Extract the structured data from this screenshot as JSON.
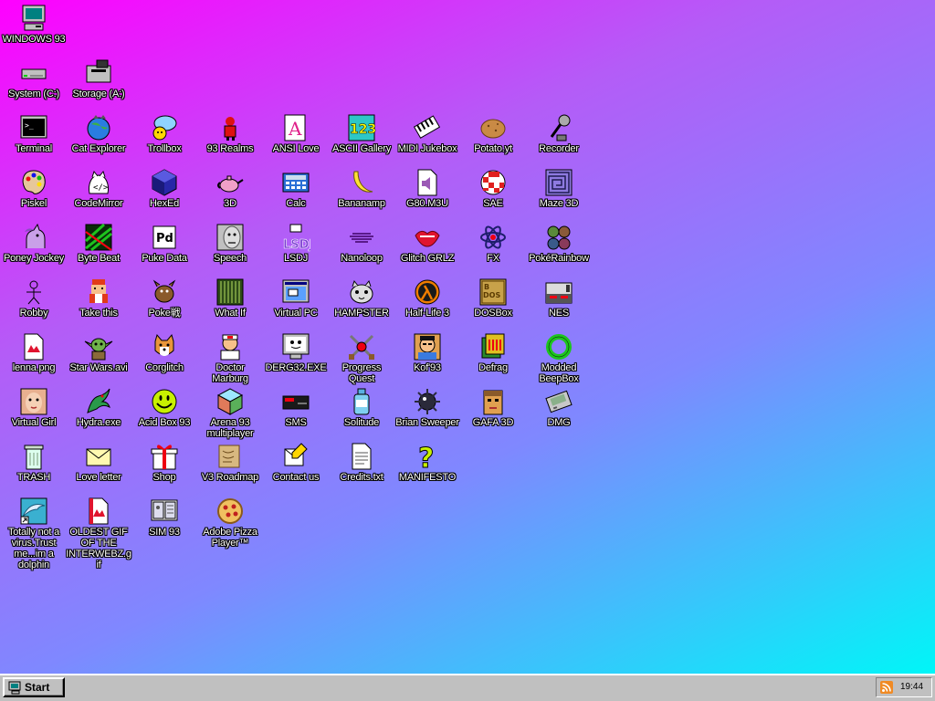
{
  "desktop": {
    "icons": [
      {
        "label": "WINDOWS 93",
        "icon": "computer-icon"
      },
      {
        "label": "System (C:)",
        "icon": "hard-drive-icon"
      },
      {
        "label": "Storage (A:)",
        "icon": "floppy-drive-icon"
      },
      {
        "label": "Terminal",
        "icon": "terminal-icon"
      },
      {
        "label": "Cat Explorer",
        "icon": "cat-globe-icon"
      },
      {
        "label": "Trollbox",
        "icon": "chat-bubble-icon"
      },
      {
        "label": "93 Realms",
        "icon": "knight-icon"
      },
      {
        "label": "ANSI Love",
        "icon": "font-a-icon"
      },
      {
        "label": "ASCII Gallery",
        "icon": "ascii-123-icon"
      },
      {
        "label": "MIDI Jukebox",
        "icon": "piano-keys-icon"
      },
      {
        "label": "Potato.yt",
        "icon": "potato-icon"
      },
      {
        "label": "Recorder",
        "icon": "microphone-icon"
      },
      {
        "label": "Piskel",
        "icon": "paint-palette-icon"
      },
      {
        "label": "CodeMirror",
        "icon": "cat-code-icon"
      },
      {
        "label": "HexEd",
        "icon": "hex-cube-icon"
      },
      {
        "label": "3D",
        "icon": "teapot-icon"
      },
      {
        "label": "Calc",
        "icon": "calculator-icon"
      },
      {
        "label": "Bananamp",
        "icon": "banana-icon"
      },
      {
        "label": "G80.M3U",
        "icon": "audio-file-icon"
      },
      {
        "label": "SAE",
        "icon": "checkered-ball-icon"
      },
      {
        "label": "Maze 3D",
        "icon": "maze-icon"
      },
      {
        "label": "Poney Jockey",
        "icon": "pony-icon"
      },
      {
        "label": "Byte Beat",
        "icon": "byte-beat-icon"
      },
      {
        "label": "Puke Data",
        "icon": "pd-icon"
      },
      {
        "label": "Speech",
        "icon": "speech-face-icon"
      },
      {
        "label": "LSDJ",
        "icon": "lsdj-icon"
      },
      {
        "label": "Nanoloop",
        "icon": "nanoloop-wave-icon"
      },
      {
        "label": "Glitch GRLZ",
        "icon": "lips-icon"
      },
      {
        "label": "FX",
        "icon": "atom-icon"
      },
      {
        "label": "PokéRainbow",
        "icon": "poke-rainbow-icon"
      },
      {
        "label": "Robby",
        "icon": "stick-figure-icon"
      },
      {
        "label": "Take this",
        "icon": "pixel-guy-icon"
      },
      {
        "label": "Poke戦",
        "icon": "poke-battle-icon"
      },
      {
        "label": "What If",
        "icon": "what-if-icon"
      },
      {
        "label": "Virtual PC",
        "icon": "virtual-pc-icon"
      },
      {
        "label": "HAMPSTER",
        "icon": "hamster-icon"
      },
      {
        "label": "Half-Life 3",
        "icon": "lambda-icon"
      },
      {
        "label": "DOSBox",
        "icon": "dosbox-icon"
      },
      {
        "label": "NES",
        "icon": "nes-console-icon"
      },
      {
        "label": "lenna.png",
        "icon": "image-file-icon"
      },
      {
        "label": "Star Wars.avi",
        "icon": "yoda-icon"
      },
      {
        "label": "Corglitch",
        "icon": "corgi-icon"
      },
      {
        "label": "Doctor Marburg",
        "icon": "doctor-icon"
      },
      {
        "label": "DERG32.EXE",
        "icon": "derg-monitor-icon"
      },
      {
        "label": "Progress Quest",
        "icon": "crossed-swords-icon"
      },
      {
        "label": "Kof'93",
        "icon": "fighter-icon"
      },
      {
        "label": "Defrag",
        "icon": "defrag-icon"
      },
      {
        "label": "Modded BeepBox",
        "icon": "ring-icon"
      },
      {
        "label": "Virtual Girl",
        "icon": "face-photo-icon"
      },
      {
        "label": "Hydra.exe",
        "icon": "hydra-icon"
      },
      {
        "label": "Acid Box 93",
        "icon": "smiley-icon"
      },
      {
        "label": "Arena 93 multiplayer",
        "icon": "cube-icon"
      },
      {
        "label": "SMS",
        "icon": "sms-console-icon"
      },
      {
        "label": "Solitude",
        "icon": "bottle-icon"
      },
      {
        "label": "Brian Sweeper",
        "icon": "mine-icon"
      },
      {
        "label": "GAFA 3D",
        "icon": "gafa-face-icon"
      },
      {
        "label": "DMG",
        "icon": "dmg-icon"
      },
      {
        "label": "TRASH",
        "icon": "trash-icon"
      },
      {
        "label": "Love letter",
        "icon": "envelope-icon"
      },
      {
        "label": "Shop",
        "icon": "gift-icon"
      },
      {
        "label": "V3 Roadmap",
        "icon": "map-scroll-icon"
      },
      {
        "label": "Contact us",
        "icon": "contact-icon"
      },
      {
        "label": "Credits.txt",
        "icon": "text-file-icon"
      },
      {
        "label": "MANIFESTO",
        "icon": "question-mark-icon"
      },
      {
        "label": "Totally not a virus.Trust me...im a dolphin",
        "icon": "dolphin-icon"
      },
      {
        "label": "OLDEST GIF OF THE INTERWEBZ.gif",
        "icon": "gif-file-icon"
      },
      {
        "label": "SIM 93",
        "icon": "sim-icon"
      },
      {
        "label": "Adobe Pizza Player™",
        "icon": "pizza-icon"
      }
    ]
  },
  "taskbar": {
    "start_label": "Start",
    "start_icon": "start-computer-icon",
    "tray_icon": "rss-icon",
    "clock": "19:44"
  }
}
